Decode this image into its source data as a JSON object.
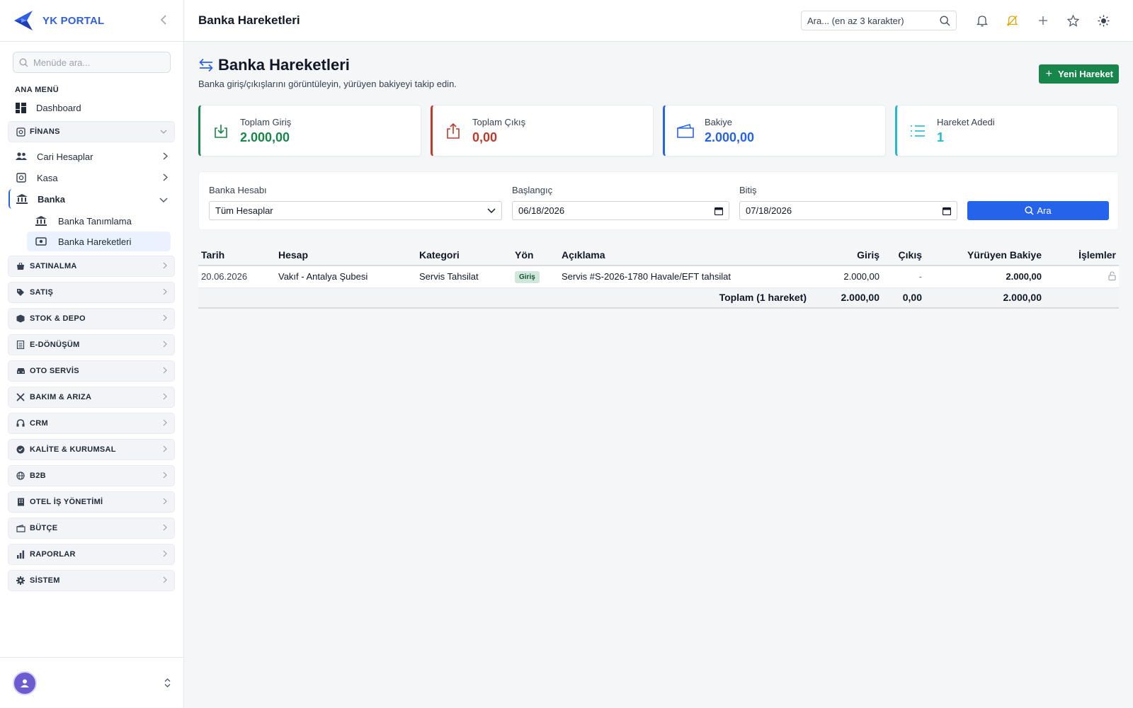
{
  "brand": {
    "name": "YK PORTAL"
  },
  "sidebar": {
    "search_placeholder": "Menüde ara...",
    "section_label": "ANA MENÜ",
    "dashboard": "Dashboard",
    "finance_group": "FİNANS",
    "finance_items": {
      "cari": "Cari Hesaplar",
      "kasa": "Kasa",
      "banka": "Banka",
      "banka_tanimlama": "Banka Tanımlama",
      "banka_hareketleri": "Banka Hareketleri"
    },
    "groups": [
      {
        "label": "SATINALMA",
        "icon": "basket-icon"
      },
      {
        "label": "SATIŞ",
        "icon": "tag-icon"
      },
      {
        "label": "STOK & DEPO",
        "icon": "box-icon"
      },
      {
        "label": "E-DÖNÜŞÜM",
        "icon": "document-icon"
      },
      {
        "label": "OTO SERVİS",
        "icon": "car-icon"
      },
      {
        "label": "BAKIM & ARIZA",
        "icon": "tools-icon"
      },
      {
        "label": "CRM",
        "icon": "headset-icon"
      },
      {
        "label": "KALİTE & KURUMSAL",
        "icon": "badge-check-icon"
      },
      {
        "label": "B2B",
        "icon": "globe-icon"
      },
      {
        "label": "OTEL İŞ YÖNETİMİ",
        "icon": "building-icon"
      },
      {
        "label": "BÜTÇE",
        "icon": "wallet-icon"
      },
      {
        "label": "RAPORLAR",
        "icon": "bar-chart-icon"
      },
      {
        "label": "SİSTEM",
        "icon": "gear-icon"
      }
    ]
  },
  "topbar": {
    "title": "Banka Hareketleri",
    "search_placeholder": "Ara... (en az 3 karakter)"
  },
  "page": {
    "title": "Banka Hareketleri",
    "subtitle": "Banka giriş/çıkışlarını görüntüleyin, yürüyen bakiyeyi takip edin.",
    "new_button": "Yeni Hareket"
  },
  "cards": {
    "giris": {
      "label": "Toplam Giriş",
      "value": "2.000,00",
      "color": "#18864b"
    },
    "cikis": {
      "label": "Toplam Çıkış",
      "value": "0,00",
      "color": "#c0392b"
    },
    "bakiye": {
      "label": "Bakiye",
      "value": "2.000,00",
      "color": "#2563eb"
    },
    "adet": {
      "label": "Hareket Adedi",
      "value": "1",
      "color": "#22b8cf"
    }
  },
  "filters": {
    "account_label": "Banka Hesabı",
    "account_value": "Tüm Hesaplar",
    "start_label": "Başlangıç",
    "start_value": "06/18/2026",
    "end_label": "Bitiş",
    "end_value": "07/18/2026",
    "search_button": "Ara"
  },
  "table": {
    "headers": {
      "tarih": "Tarih",
      "hesap": "Hesap",
      "kategori": "Kategori",
      "yon": "Yön",
      "aciklama": "Açıklama",
      "giris": "Giriş",
      "cikis": "Çıkış",
      "bakiye": "Yürüyen Bakiye",
      "islemler": "İşlemler"
    },
    "row": {
      "tarih": "20.06.2026",
      "hesap": "Vakıf - Antalya Şubesi",
      "kategori": "Servis Tahsilat",
      "yon": "Giriş",
      "aciklama": "Servis #S-2026-1780 Havale/EFT tahsilat",
      "giris": "2.000,00",
      "cikis": "-",
      "bakiye": "2.000,00"
    },
    "total": {
      "label": "Toplam (1 hareket)",
      "giris": "2.000,00",
      "cikis": "0,00",
      "bakiye": "2.000,00"
    }
  }
}
